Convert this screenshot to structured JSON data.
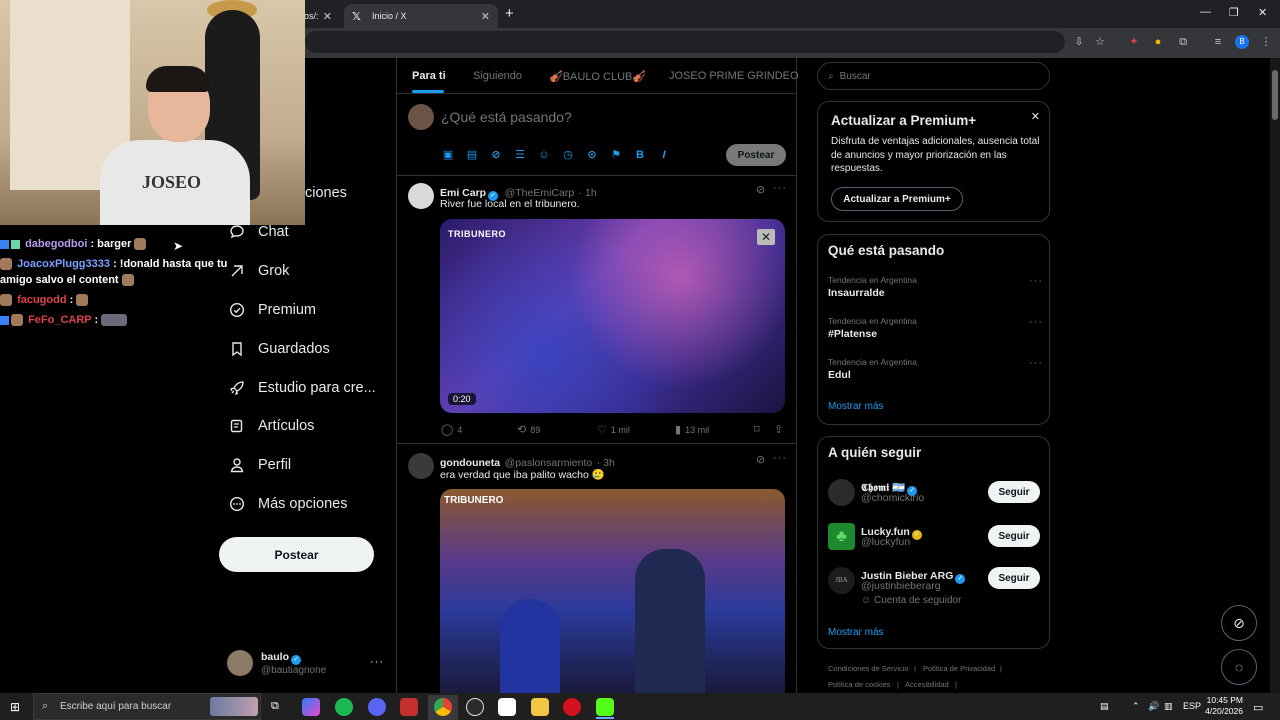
{
  "browser": {
    "tabs": [
      {
        "label": "os/:",
        "active": false
      },
      {
        "label": "Inicio / X",
        "active": true
      }
    ]
  },
  "chat": {
    "lines": [
      {
        "user": "dabegodboi",
        "user_color": "#b89cf0",
        "message": ": barger"
      },
      {
        "user": "JoacoxPlugg3333",
        "user_color": "#7aa0ff",
        "message": ": !donald hasta que tu amigo salvo el content"
      },
      {
        "user": "facugodd",
        "user_color": "#e0414b",
        "message": ":"
      },
      {
        "user": "FeFo_CARP",
        "user_color": "#e0414b",
        "message": ":"
      }
    ]
  },
  "nav": {
    "partial_item": "ciones",
    "items": [
      {
        "label": "Chat",
        "icon": "chat-icon"
      },
      {
        "label": "Grok",
        "icon": "grok-icon"
      },
      {
        "label": "Premium",
        "icon": "premium-icon"
      },
      {
        "label": "Guardados",
        "icon": "bookmark-icon"
      },
      {
        "label": "Estudio para cre...",
        "icon": "rocket-icon"
      },
      {
        "label": "Artículos",
        "icon": "articles-icon"
      },
      {
        "label": "Perfil",
        "icon": "profile-icon"
      },
      {
        "label": "Más opciones",
        "icon": "more-options-icon"
      }
    ],
    "post_button": "Postear",
    "profile": {
      "name": "baulo",
      "handle": "@bautiagnone"
    }
  },
  "feed": {
    "tabs": [
      "Para ti",
      "Siguiendo",
      "🎻BAULO CLUB🎻",
      "JOSEO PRIME GRINDEO"
    ],
    "composer": {
      "placeholder": "¿Qué está pasando?",
      "post_label": "Postear"
    },
    "tweets": [
      {
        "name": "Emi Carp",
        "handle": "@TheEmiCarp",
        "time": "· 1h",
        "text": "River fue local en el tribunero.",
        "video_duration": "0:20",
        "media_label": "TRIBUNERO",
        "replies": "4",
        "retweets": "89",
        "likes": "1 mil",
        "views": "13 mil"
      },
      {
        "name": "gondouneta",
        "handle": "@paslonsarmiento",
        "time": "· 3h",
        "text": "era verdad que iba palito wacho 🥲",
        "media_label": "TRIBUNERO"
      }
    ]
  },
  "sidebar": {
    "search_placeholder": "Buscar",
    "premium": {
      "title": "Actualizar a Premium+",
      "body": "Disfruta de ventajas adicionales, ausencia total de anuncios y mayor priorización en las respuestas.",
      "button": "Actualizar a Premium+"
    },
    "trends": {
      "title": "Qué está pasando",
      "items": [
        {
          "context": "Tendencia en Argentina",
          "name": "Insaurralde"
        },
        {
          "context": "Tendencia en Argentina",
          "name": "#Platense"
        },
        {
          "context": "Tendencia en Argentina",
          "name": "Edul"
        }
      ],
      "show_more": "Mostrar más"
    },
    "who_to_follow": {
      "title": "A quién seguir",
      "users": [
        {
          "name": "𝕮𝖍𝖔𝖒𝖎 🇦🇷",
          "handle": "@chomickirio",
          "badge": "blue",
          "extra": ""
        },
        {
          "name": "Lucky.fun",
          "handle": "@luckyfun",
          "badge": "gold",
          "extra": ""
        },
        {
          "name": "Justin Bieber ARG",
          "handle": "@justinbieberarg",
          "badge": "blue",
          "extra": "Cuenta de seguidor"
        }
      ],
      "follow_label": "Seguir",
      "show_more": "Mostrar más"
    },
    "footer": [
      "Condiciones de Servicio",
      "Política de Privacidad",
      "Política de cookies",
      "Accesibilidad"
    ]
  },
  "taskbar": {
    "search_placeholder": "Escribe aquí para buscar",
    "lang": "ESP",
    "time": "10:45 PM",
    "date": "4/20/2026"
  },
  "colors": {
    "accent": "#1d9bf0",
    "background": "#000000",
    "border": "#2f3336",
    "muted": "#71767b"
  }
}
